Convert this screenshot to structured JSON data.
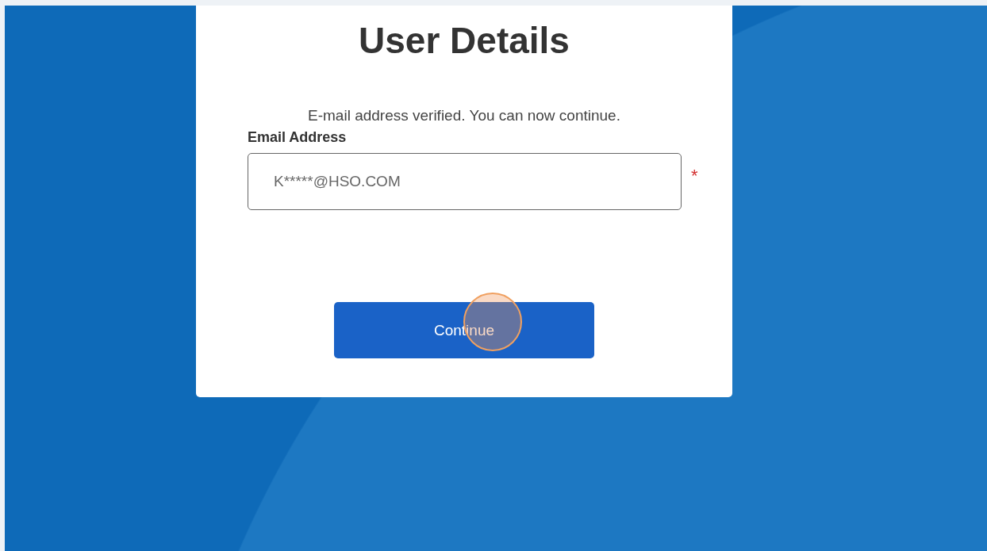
{
  "card": {
    "title": "User Details",
    "message": "E-mail address verified. You can now continue.",
    "email_field": {
      "label": "Email Address",
      "value": "K*****@HSO.COM",
      "required_mark": "*"
    },
    "button": {
      "label": "Continue"
    }
  }
}
